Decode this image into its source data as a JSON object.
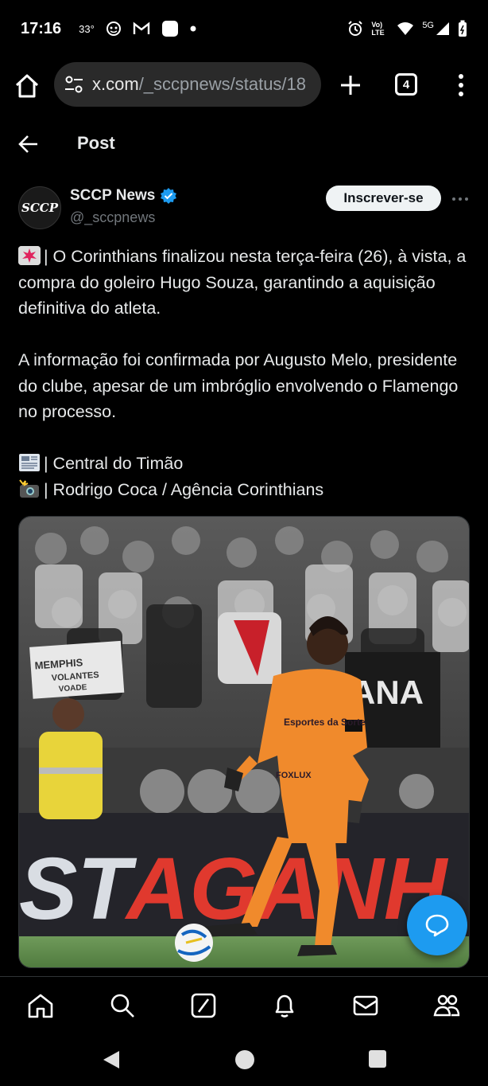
{
  "status_bar": {
    "time": "17:16",
    "temperature": "33°",
    "network_label": "5G",
    "lte_label": "Vo) LTE"
  },
  "browser": {
    "url_domain": "x.com",
    "url_path": "/_sccpnews/status/18",
    "tab_count": "4"
  },
  "page": {
    "title": "Post"
  },
  "author": {
    "avatar_text": "SCCP",
    "name": "SCCP News",
    "handle": "@_sccpnews",
    "subscribe_label": "Inscrever-se"
  },
  "tweet": {
    "paragraph_1": "| O Corinthians finalizou nesta terça-feira (26), à vista, a compra do goleiro Hugo Souza, garantindo a aquisição definitiva do atleta.",
    "paragraph_2": "A informação foi confirmada por Augusto Melo, presidente do clube, apesar de um imbróglio envolvendo o Flamengo no processo.",
    "credit_1": "| Central do Timão",
    "credit_2": "| Rodrigo Coca / Agência Corinthians"
  },
  "media": {
    "banner_fragment_1": "ST",
    "banner_fragment_2": "AGANH",
    "sign_text_1": "MEMPHIS",
    "sign_text_2": "VOLANTES",
    "sign_text_3": "VOADE",
    "flag_text": "ANA",
    "shirt_sponsor": "Esportes da Sorte",
    "shirt_sponsor_2": "FOXLUX"
  },
  "colors": {
    "accent": "#1d9bf0",
    "background": "#000000",
    "text_primary": "#e7e9ea",
    "text_secondary": "#71767b",
    "keeper_kit": "#f08a2c"
  }
}
